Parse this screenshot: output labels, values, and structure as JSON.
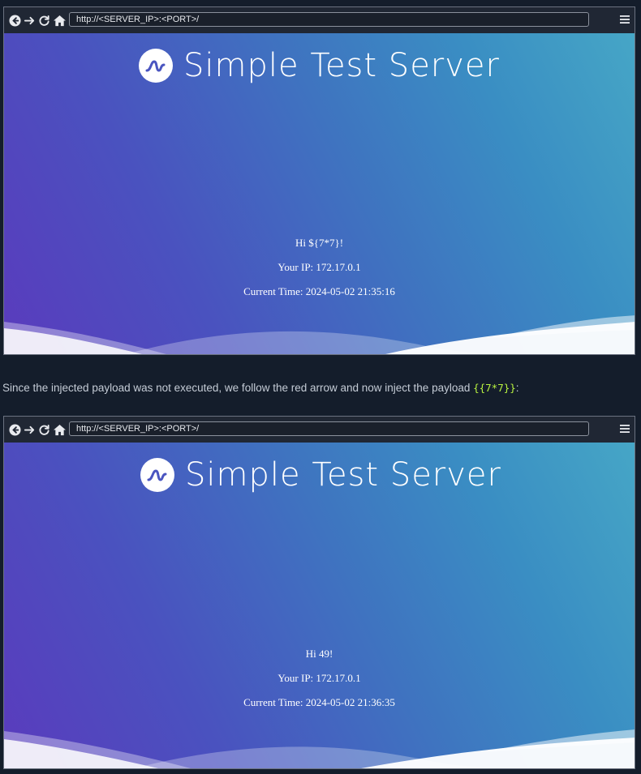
{
  "browser_top": {
    "url": "http://<SERVER_IP>:<PORT>/",
    "brand_title": "Simple Test Server",
    "greeting": "Hi ${7*7}!",
    "ip_line": "Your IP: 172.17.0.1",
    "time_line": "Current Time: 2024-05-02 21:35:16"
  },
  "caption": {
    "text": "Since the injected payload was not executed, we follow the red arrow and now inject the payload ",
    "payload": "{{7*7}}",
    "suffix": ":"
  },
  "browser_bottom": {
    "url": "http://<SERVER_IP>:<PORT>/",
    "brand_title": "Simple Test Server",
    "greeting": "Hi 49!",
    "ip_line": "Your IP: 172.17.0.1",
    "time_line": "Current Time: 2024-05-02 21:36:35"
  },
  "icons": {
    "back": "back-circle-icon",
    "forward": "arrow-right-icon",
    "reload": "reload-icon",
    "home": "home-icon",
    "menu": "hamburger-menu-icon",
    "logo": "wave-logo-icon"
  },
  "colors": {
    "page_bg": "#141d2b",
    "payload": "#b8f240",
    "gradient_start": "#5a3bbd",
    "gradient_end": "#46a6c6"
  }
}
